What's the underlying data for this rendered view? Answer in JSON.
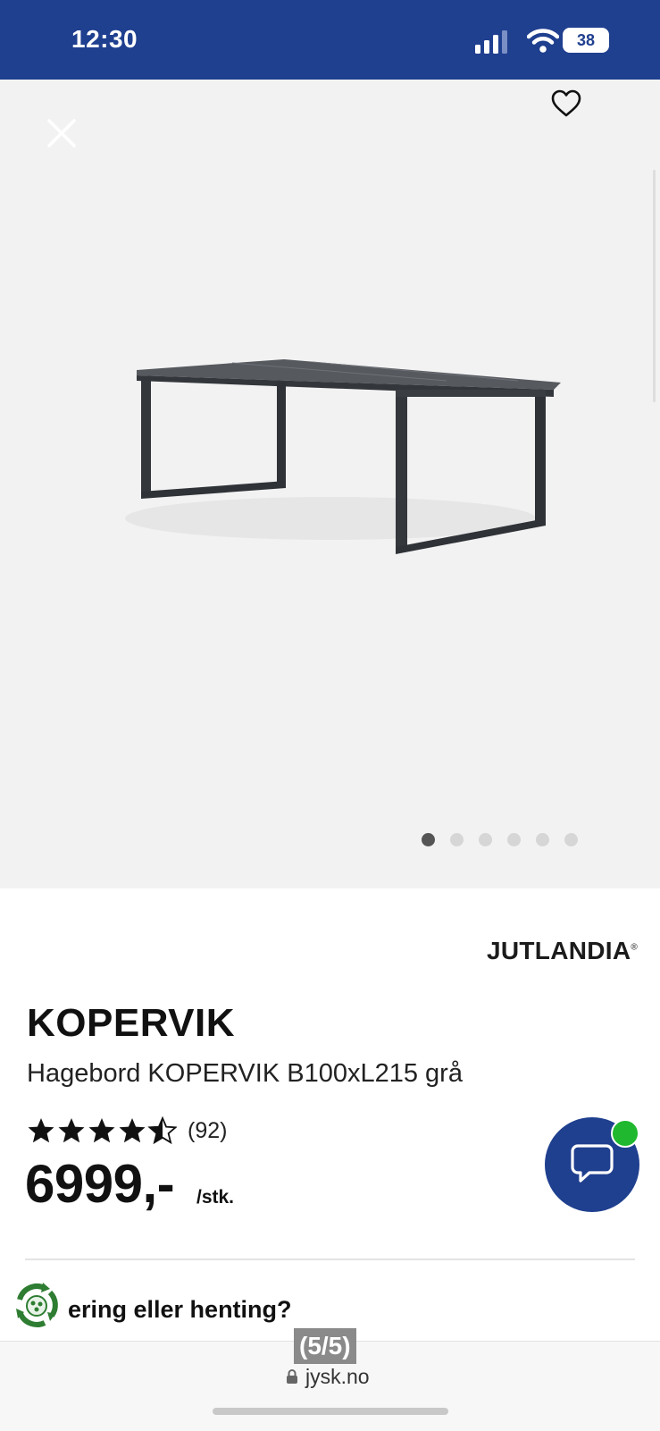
{
  "status_bar": {
    "time": "12:30",
    "battery": "38"
  },
  "gallery": {
    "image_alt": "Hagebord KOPERVIK",
    "total_images": 6,
    "active_index": 0
  },
  "product": {
    "brand": "JUTLANDIA",
    "brand_mark": "®",
    "name": "KOPERVIK",
    "subtitle": "Hagebord KOPERVIK B100xL215 grå",
    "rating": 4.5,
    "review_count": "(92)",
    "price": "6999,-",
    "unit": "/stk."
  },
  "delivery": {
    "label": "ering eller henting?"
  },
  "browser": {
    "page_counter": "(5/5)",
    "url": "jysk.no"
  },
  "colors": {
    "brand_blue": "#1f3f8f",
    "online_green": "#1fb82e",
    "gallery_bg": "#f2f2f2"
  },
  "icons": {
    "close": "close-icon",
    "favorite": "heart-icon",
    "chat": "chat-bubble-icon",
    "lock": "lock-icon",
    "eco": "eco-badge-icon"
  }
}
